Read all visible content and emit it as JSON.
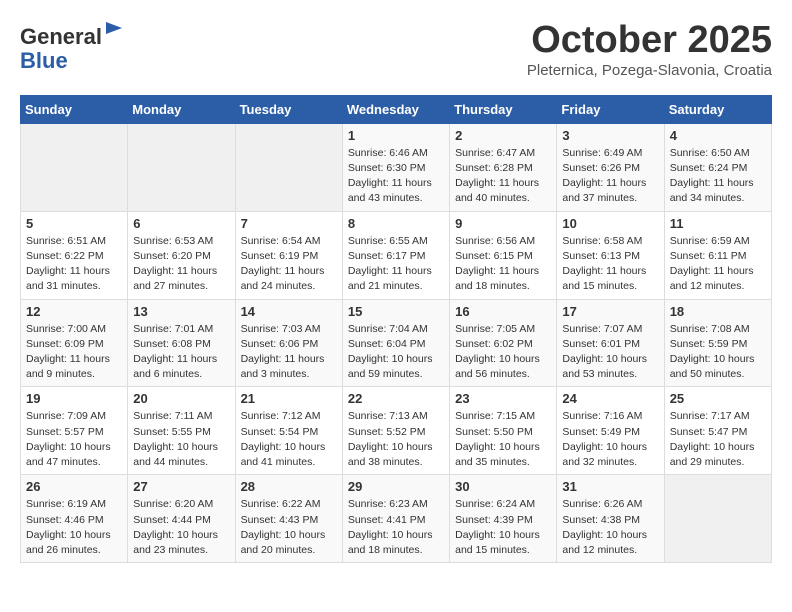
{
  "header": {
    "logo_general": "General",
    "logo_blue": "Blue",
    "month_title": "October 2025",
    "subtitle": "Pleternica, Pozega-Slavonia, Croatia"
  },
  "weekdays": [
    "Sunday",
    "Monday",
    "Tuesday",
    "Wednesday",
    "Thursday",
    "Friday",
    "Saturday"
  ],
  "weeks": [
    [
      {
        "day": "",
        "info": ""
      },
      {
        "day": "",
        "info": ""
      },
      {
        "day": "",
        "info": ""
      },
      {
        "day": "1",
        "info": "Sunrise: 6:46 AM\nSunset: 6:30 PM\nDaylight: 11 hours\nand 43 minutes."
      },
      {
        "day": "2",
        "info": "Sunrise: 6:47 AM\nSunset: 6:28 PM\nDaylight: 11 hours\nand 40 minutes."
      },
      {
        "day": "3",
        "info": "Sunrise: 6:49 AM\nSunset: 6:26 PM\nDaylight: 11 hours\nand 37 minutes."
      },
      {
        "day": "4",
        "info": "Sunrise: 6:50 AM\nSunset: 6:24 PM\nDaylight: 11 hours\nand 34 minutes."
      }
    ],
    [
      {
        "day": "5",
        "info": "Sunrise: 6:51 AM\nSunset: 6:22 PM\nDaylight: 11 hours\nand 31 minutes."
      },
      {
        "day": "6",
        "info": "Sunrise: 6:53 AM\nSunset: 6:20 PM\nDaylight: 11 hours\nand 27 minutes."
      },
      {
        "day": "7",
        "info": "Sunrise: 6:54 AM\nSunset: 6:19 PM\nDaylight: 11 hours\nand 24 minutes."
      },
      {
        "day": "8",
        "info": "Sunrise: 6:55 AM\nSunset: 6:17 PM\nDaylight: 11 hours\nand 21 minutes."
      },
      {
        "day": "9",
        "info": "Sunrise: 6:56 AM\nSunset: 6:15 PM\nDaylight: 11 hours\nand 18 minutes."
      },
      {
        "day": "10",
        "info": "Sunrise: 6:58 AM\nSunset: 6:13 PM\nDaylight: 11 hours\nand 15 minutes."
      },
      {
        "day": "11",
        "info": "Sunrise: 6:59 AM\nSunset: 6:11 PM\nDaylight: 11 hours\nand 12 minutes."
      }
    ],
    [
      {
        "day": "12",
        "info": "Sunrise: 7:00 AM\nSunset: 6:09 PM\nDaylight: 11 hours\nand 9 minutes."
      },
      {
        "day": "13",
        "info": "Sunrise: 7:01 AM\nSunset: 6:08 PM\nDaylight: 11 hours\nand 6 minutes."
      },
      {
        "day": "14",
        "info": "Sunrise: 7:03 AM\nSunset: 6:06 PM\nDaylight: 11 hours\nand 3 minutes."
      },
      {
        "day": "15",
        "info": "Sunrise: 7:04 AM\nSunset: 6:04 PM\nDaylight: 10 hours\nand 59 minutes."
      },
      {
        "day": "16",
        "info": "Sunrise: 7:05 AM\nSunset: 6:02 PM\nDaylight: 10 hours\nand 56 minutes."
      },
      {
        "day": "17",
        "info": "Sunrise: 7:07 AM\nSunset: 6:01 PM\nDaylight: 10 hours\nand 53 minutes."
      },
      {
        "day": "18",
        "info": "Sunrise: 7:08 AM\nSunset: 5:59 PM\nDaylight: 10 hours\nand 50 minutes."
      }
    ],
    [
      {
        "day": "19",
        "info": "Sunrise: 7:09 AM\nSunset: 5:57 PM\nDaylight: 10 hours\nand 47 minutes."
      },
      {
        "day": "20",
        "info": "Sunrise: 7:11 AM\nSunset: 5:55 PM\nDaylight: 10 hours\nand 44 minutes."
      },
      {
        "day": "21",
        "info": "Sunrise: 7:12 AM\nSunset: 5:54 PM\nDaylight: 10 hours\nand 41 minutes."
      },
      {
        "day": "22",
        "info": "Sunrise: 7:13 AM\nSunset: 5:52 PM\nDaylight: 10 hours\nand 38 minutes."
      },
      {
        "day": "23",
        "info": "Sunrise: 7:15 AM\nSunset: 5:50 PM\nDaylight: 10 hours\nand 35 minutes."
      },
      {
        "day": "24",
        "info": "Sunrise: 7:16 AM\nSunset: 5:49 PM\nDaylight: 10 hours\nand 32 minutes."
      },
      {
        "day": "25",
        "info": "Sunrise: 7:17 AM\nSunset: 5:47 PM\nDaylight: 10 hours\nand 29 minutes."
      }
    ],
    [
      {
        "day": "26",
        "info": "Sunrise: 6:19 AM\nSunset: 4:46 PM\nDaylight: 10 hours\nand 26 minutes."
      },
      {
        "day": "27",
        "info": "Sunrise: 6:20 AM\nSunset: 4:44 PM\nDaylight: 10 hours\nand 23 minutes."
      },
      {
        "day": "28",
        "info": "Sunrise: 6:22 AM\nSunset: 4:43 PM\nDaylight: 10 hours\nand 20 minutes."
      },
      {
        "day": "29",
        "info": "Sunrise: 6:23 AM\nSunset: 4:41 PM\nDaylight: 10 hours\nand 18 minutes."
      },
      {
        "day": "30",
        "info": "Sunrise: 6:24 AM\nSunset: 4:39 PM\nDaylight: 10 hours\nand 15 minutes."
      },
      {
        "day": "31",
        "info": "Sunrise: 6:26 AM\nSunset: 4:38 PM\nDaylight: 10 hours\nand 12 minutes."
      },
      {
        "day": "",
        "info": ""
      }
    ]
  ]
}
